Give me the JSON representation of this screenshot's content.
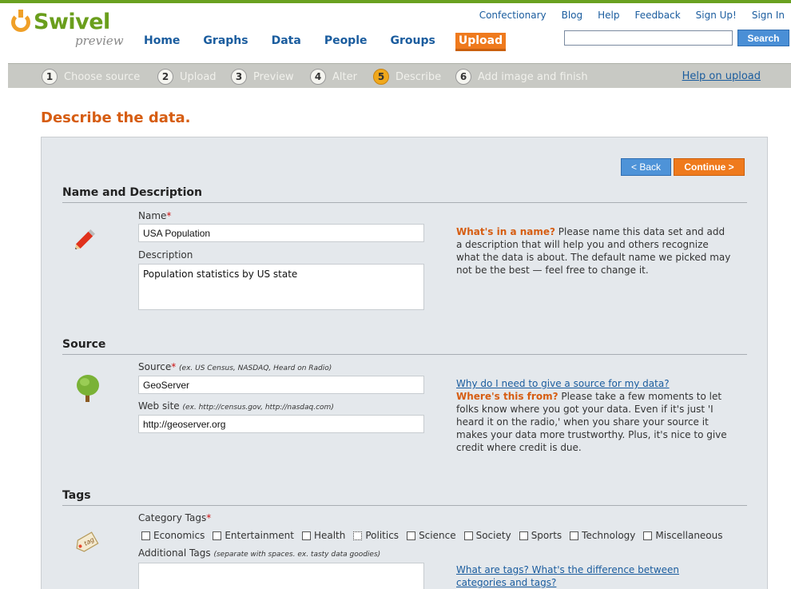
{
  "brand": {
    "name": "Swivel",
    "tagline": "preview"
  },
  "utility_nav": [
    "Confectionary",
    "Blog",
    "Help",
    "Feedback",
    "Sign Up!",
    "Sign In"
  ],
  "main_nav": [
    {
      "label": "Home",
      "active": false
    },
    {
      "label": "Graphs",
      "active": false
    },
    {
      "label": "Data",
      "active": false
    },
    {
      "label": "People",
      "active": false
    },
    {
      "label": "Groups",
      "active": false
    },
    {
      "label": "Upload",
      "active": true
    }
  ],
  "search": {
    "value": "",
    "button": "Search"
  },
  "steps": [
    {
      "num": "1",
      "label": "Choose source"
    },
    {
      "num": "2",
      "label": "Upload"
    },
    {
      "num": "3",
      "label": "Preview"
    },
    {
      "num": "4",
      "label": "Alter"
    },
    {
      "num": "5",
      "label": "Describe",
      "current": true
    },
    {
      "num": "6",
      "label": "Add image and finish"
    }
  ],
  "help_upload": "Help on upload",
  "page_title": "Describe the data.",
  "buttons": {
    "back": "< Back",
    "continue": "Continue >"
  },
  "name_section": {
    "heading": "Name and Description",
    "name_label": "Name",
    "name_value": "USA Population",
    "description_label": "Description",
    "description_value": "Population statistics by US state",
    "help_lead": "What's in a name?",
    "help_text": " Please name this data set and add a description that will help you and others recognize what the data is about. The default name we picked may not be the best — feel free to change it."
  },
  "source_section": {
    "heading": "Source",
    "source_label": "Source",
    "source_hint": "(ex. US Census, NASDAQ, Heard on Radio)",
    "source_value": "GeoServer",
    "website_label": "Web site",
    "website_hint": "(ex. http://census.gov, http://nasdaq.com)",
    "website_value": "http://geoserver.org",
    "help_link": "Why do I need to give a source for my data?",
    "help_lead": "Where's this from?",
    "help_text": " Please take a few moments to let folks know where you got your data. Even if it's just 'I heard it on the radio,' when you share your source it makes your data more trustworthy. Plus, it's nice to give credit where credit is due."
  },
  "tags_section": {
    "heading": "Tags",
    "category_label": "Category Tags",
    "categories": [
      "Economics",
      "Entertainment",
      "Health",
      "Politics",
      "Science",
      "Society",
      "Sports",
      "Technology",
      "Miscellaneous"
    ],
    "additional_label": "Additional Tags",
    "additional_hint": "(separate with spaces. ex. tasty data goodies)",
    "additional_value": "",
    "help_link": "What are tags? What's the difference between categories and tags?"
  },
  "icons": {
    "name": "pencil-icon",
    "source": "tree-icon",
    "tags": "tag-icon"
  }
}
